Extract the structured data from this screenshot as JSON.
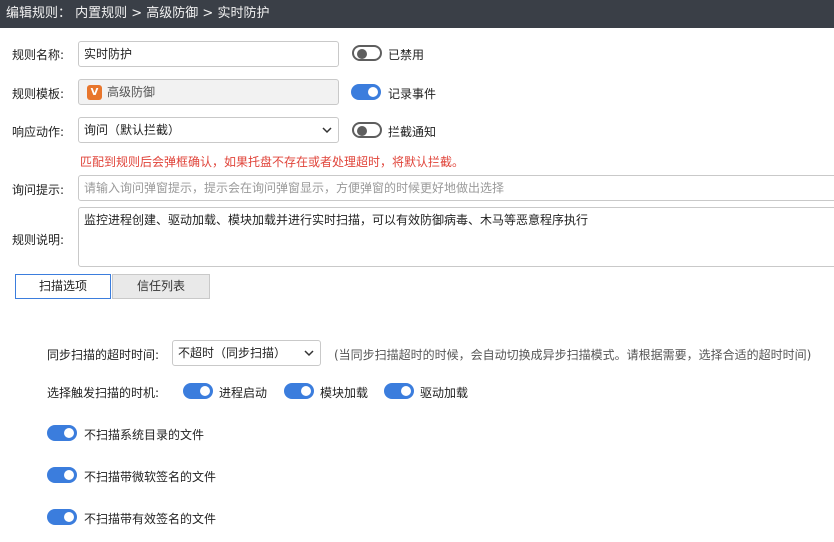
{
  "title": "编辑规则： 内置规则 > 高级防御 > 实时防护",
  "form": {
    "name_label": "规则名称:",
    "name_value": "实时防护",
    "template_label": "规则模板:",
    "template_badge": "V",
    "template_value": "高级防御",
    "action_label": "响应动作:",
    "action_value": "询问（默认拦截）",
    "disabled_toggle_label": "已禁用",
    "record_toggle_label": "记录事件",
    "intercept_toggle_label": "拦截通知",
    "warning_text": "匹配到规则后会弹框确认，如果托盘不存在或者处理超时，将默认拦截。",
    "prompt_label": "询问提示:",
    "prompt_placeholder": "请输入询问弹窗提示，提示会在询问弹窗显示，方便弹窗的时候更好地做出选择",
    "desc_label": "规则说明:",
    "desc_value": "监控进程创建、驱动加载、模块加载并进行实时扫描，可以有效防御病毒、木马等恶意程序执行"
  },
  "toggles": {
    "disabled": false,
    "record": true,
    "intercept": false
  },
  "tabs": [
    {
      "label": "扫描选项",
      "active": true
    },
    {
      "label": "信任列表",
      "active": false
    }
  ],
  "scan": {
    "timeout_label": "同步扫描的超时时间:",
    "timeout_value": "不超时（同步扫描）",
    "timeout_hint": "(当同步扫描超时的时候，会自动切换成异步扫描模式。请根据需要，选择合适的超时时间)",
    "trigger_label": "选择触发扫描的时机:",
    "trigger_options": [
      {
        "label": "进程启动",
        "on": true
      },
      {
        "label": "模块加载",
        "on": true
      },
      {
        "label": "驱动加载",
        "on": true
      }
    ],
    "skip_options": [
      {
        "label": "不扫描系统目录的文件",
        "on": true
      },
      {
        "label": "不扫描带微软签名的文件",
        "on": true
      },
      {
        "label": "不扫描带有效签名的文件",
        "on": true
      }
    ]
  },
  "colors": {
    "accent": "#3b7ddd",
    "warning": "#e0443a",
    "titlebar": "#3a3f47",
    "badge": "#e8762d"
  }
}
